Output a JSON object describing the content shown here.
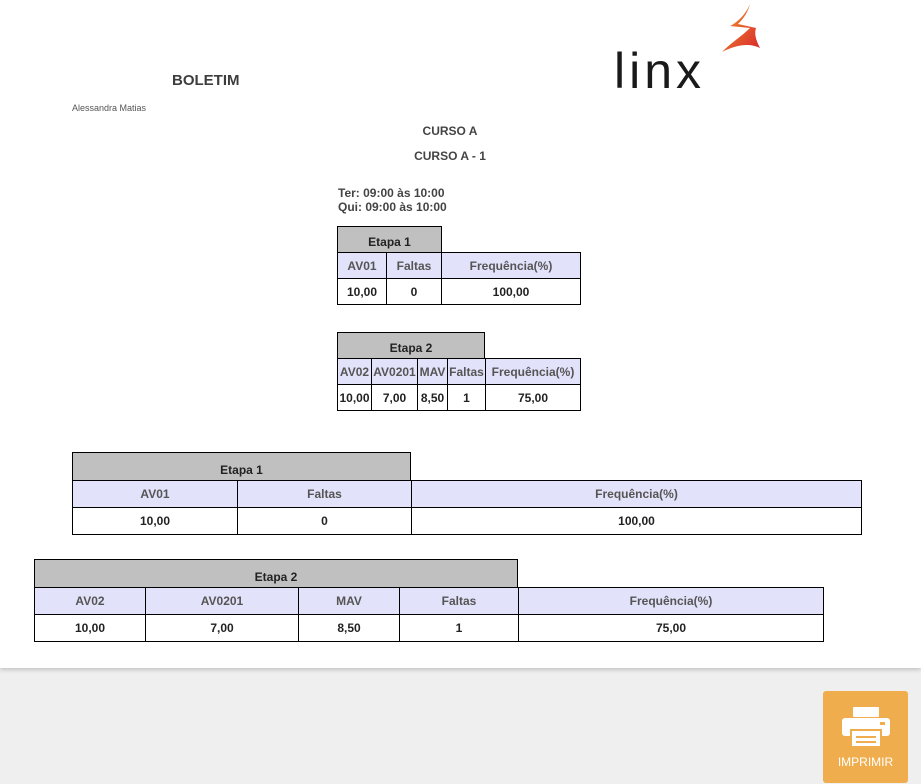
{
  "report": {
    "title": "BOLETIM",
    "student": "Alessandra Matias",
    "course": "CURSO A",
    "class": "CURSO A - 1",
    "schedule": [
      "Ter: 09:00 às 10:00",
      "Qui: 09:00 às 10:00"
    ]
  },
  "logo": {
    "text": "Linx",
    "accent_color": "#e8432d"
  },
  "stages": [
    {
      "title": "Etapa 1",
      "headers": [
        "AV01",
        "Faltas",
        "Frequência(%)"
      ],
      "values": [
        "10,00",
        "0",
        "100,00"
      ]
    },
    {
      "title": "Etapa 2",
      "headers": [
        "AV02",
        "AV0201",
        "MAV",
        "Faltas",
        "Frequência(%)"
      ],
      "values": [
        "10,00",
        "7,00",
        "8,50",
        "1",
        "75,00"
      ]
    }
  ],
  "print_button": {
    "label": "IMPRIMIR",
    "icon": "printer-icon",
    "color": "#f0ad4e"
  }
}
